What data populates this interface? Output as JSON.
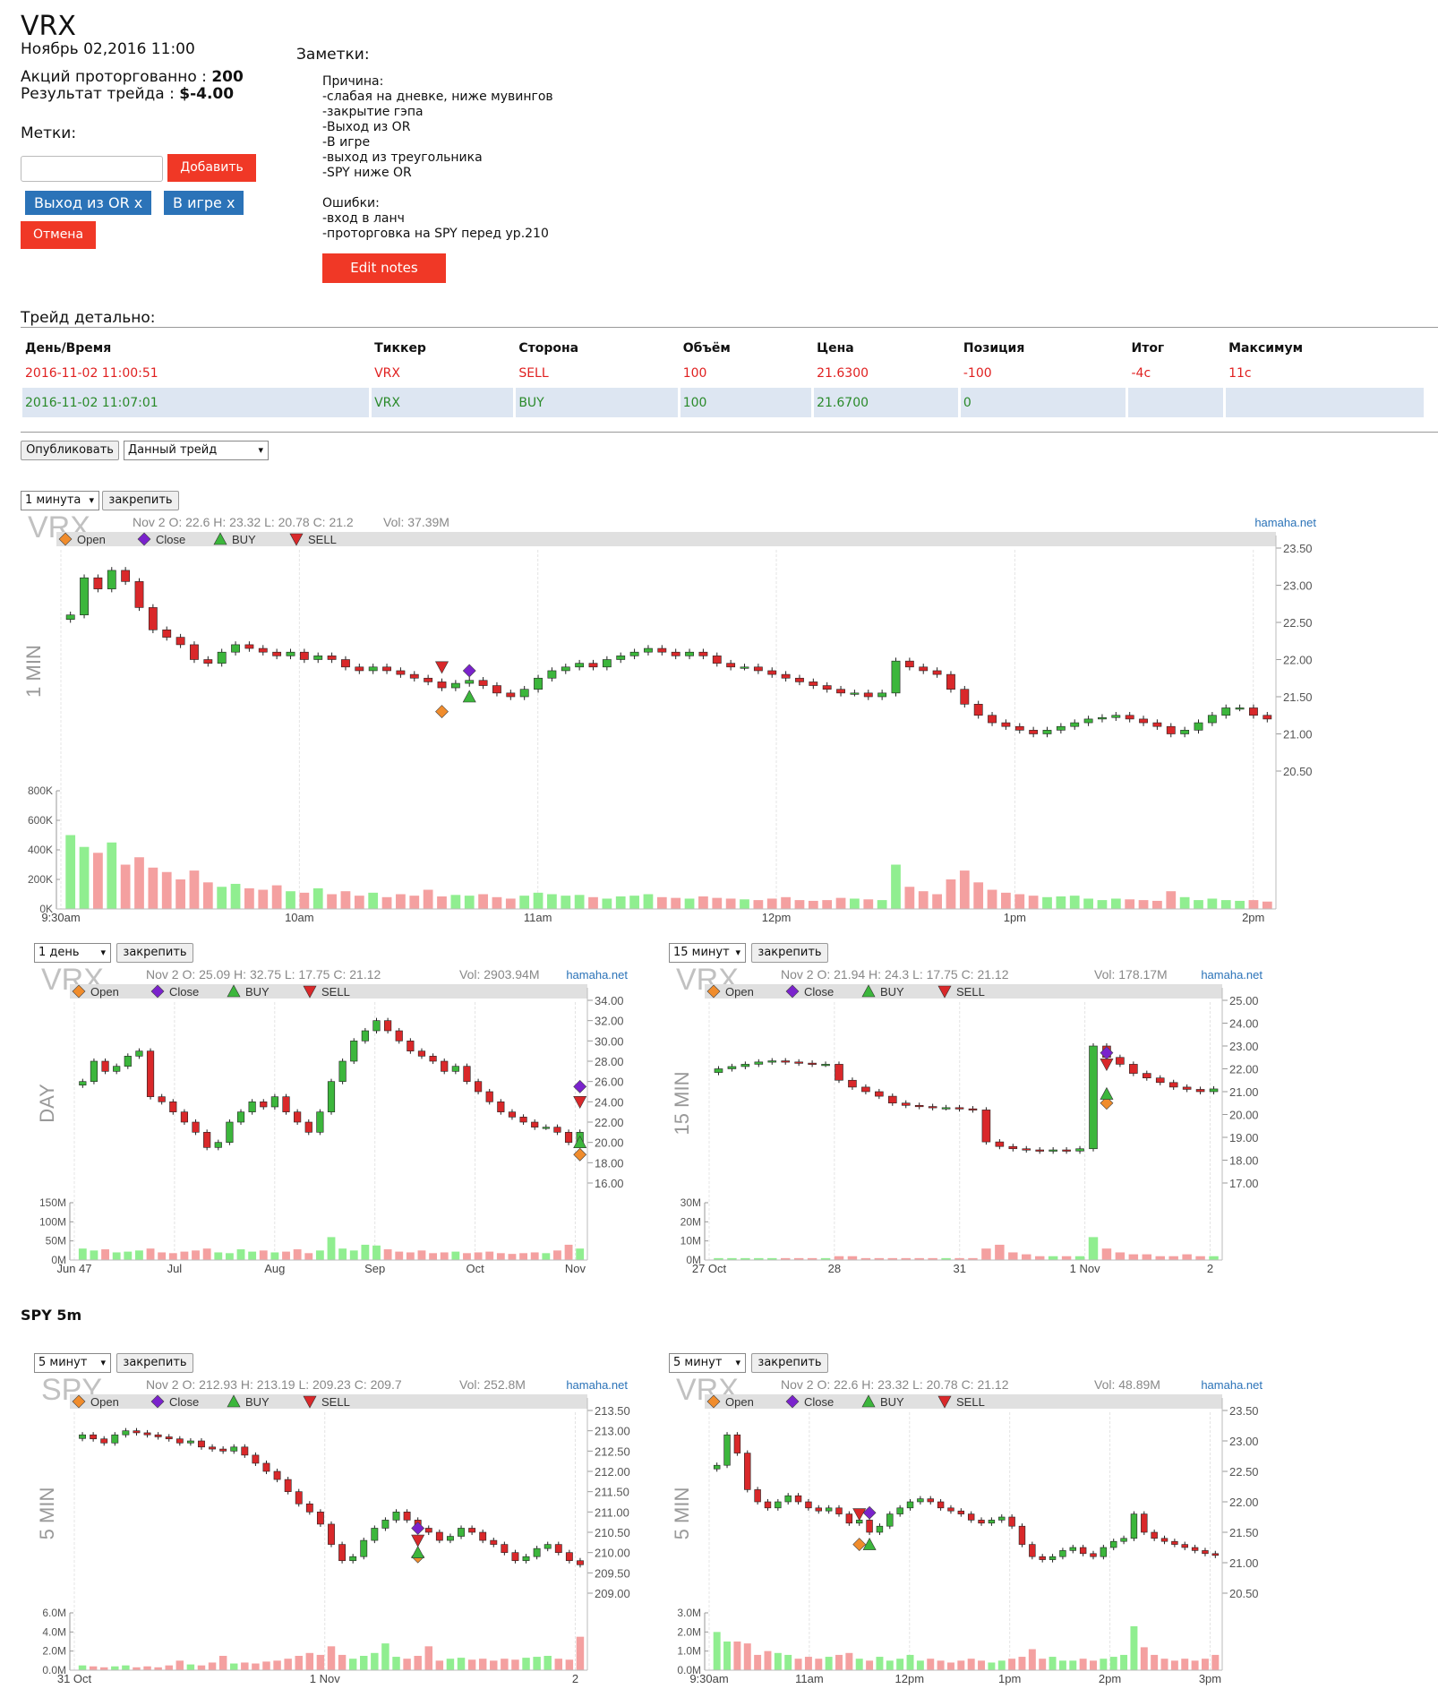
{
  "header": {
    "title": "VRX",
    "date": "Ноябрь 02,2016 11:00",
    "shares_label": "Акций проторгованно :",
    "shares_value": "200",
    "result_label": "Результат трейда :",
    "result_value": "$-4.00",
    "marks_label": "Метки:",
    "add_label": "Добавить",
    "tags": [
      "Выход из OR x",
      "В игре x"
    ],
    "cancel_label": "Отмена"
  },
  "notes": {
    "label": "Заметки:",
    "lines": [
      "Причина:",
      "-слабая на дневке, ниже мувингов",
      "-закрытие гэпа",
      "-Выход из OR",
      "-В игре",
      "-выход из треугольника",
      "-SPY ниже OR",
      "",
      "Ошибки:",
      "-вход в ланч",
      "-проторговка на SPY перед ур.210"
    ],
    "edit_label": "Edit notes"
  },
  "detail": {
    "label": "Трейд детально:",
    "columns": [
      "День/Время",
      "Тиккер",
      "Сторона",
      "Объём",
      "Цена",
      "Позиция",
      "Итог",
      "Максимум"
    ],
    "rows": [
      [
        "2016-11-02 11:00:51",
        "VRX",
        "SELL",
        "100",
        "21.6300",
        "-100",
        "-4c",
        "11c"
      ],
      [
        "2016-11-02 11:07:01",
        "VRX",
        "BUY",
        "100",
        "21.6700",
        "0",
        "",
        ""
      ]
    ]
  },
  "controls": {
    "publish_label": "Опубликовать",
    "trade_select": "Данный трейд",
    "pin_label": "закрепить"
  },
  "spy_title": "SPY 5m",
  "legend": {
    "open": "Open",
    "close": "Close",
    "buy": "BUY",
    "sell": "SELL"
  },
  "colors": {
    "up": "#3cb63c",
    "down": "#d9282a",
    "open_marker": "#f08c2c",
    "close_marker": "#7a22cc",
    "vol_up": "#90ee90",
    "vol_down": "#f4a0a0",
    "button_red": "#f03826",
    "tag_blue": "#2b73b8"
  },
  "chart_data": [
    {
      "type": "candlestick",
      "ticker": "VRX",
      "interval_select": "1 минута",
      "side_label": "1 MIN",
      "info": "Nov 2 O: 22.6 H: 23.32 L: 20.78 C: 21.2",
      "vol": "Vol: 37.39M",
      "watermark": "hamaha.net",
      "yticks": [
        "23.50",
        "23.00",
        "22.50",
        "22.00",
        "21.50",
        "21.00",
        "20.50"
      ],
      "ylim": [
        20.5,
        23.5
      ],
      "vticks": [
        "800K",
        "600K",
        "400K",
        "200K",
        "0K"
      ],
      "vmax": 800,
      "xticks": [
        "9:30am",
        "10am",
        "11am",
        "12pm",
        "1pm",
        "2pm"
      ],
      "points": [
        22.6,
        23.1,
        22.95,
        23.2,
        23.05,
        22.7,
        22.4,
        22.3,
        22.2,
        22.0,
        21.95,
        22.1,
        22.2,
        22.15,
        22.1,
        22.05,
        22.1,
        22.0,
        22.05,
        22.0,
        21.9,
        21.85,
        21.9,
        21.85,
        21.8,
        21.75,
        21.7,
        21.62,
        21.68,
        21.72,
        21.65,
        21.55,
        21.5,
        21.6,
        21.75,
        21.85,
        21.9,
        21.95,
        21.9,
        22.0,
        22.05,
        22.1,
        22.15,
        22.1,
        22.05,
        22.1,
        22.05,
        21.95,
        21.9,
        21.9,
        21.85,
        21.8,
        21.75,
        21.7,
        21.65,
        21.6,
        21.55,
        21.55,
        21.5,
        21.55,
        21.98,
        21.9,
        21.85,
        21.8,
        21.6,
        21.4,
        21.25,
        21.15,
        21.1,
        21.05,
        21.0,
        21.05,
        21.1,
        21.15,
        21.2,
        21.22,
        21.25,
        21.2,
        21.15,
        21.1,
        21.0,
        21.05,
        21.15,
        21.25,
        21.35,
        21.35,
        21.25,
        21.2
      ],
      "volumes": [
        500,
        420,
        380,
        450,
        300,
        350,
        280,
        250,
        200,
        260,
        180,
        150,
        170,
        140,
        130,
        160,
        120,
        110,
        140,
        100,
        120,
        90,
        110,
        80,
        100,
        90,
        130,
        85,
        95,
        90,
        100,
        80,
        70,
        90,
        110,
        100,
        90,
        95,
        80,
        70,
        85,
        90,
        100,
        80,
        75,
        70,
        85,
        75,
        70,
        65,
        60,
        70,
        80,
        60,
        55,
        60,
        75,
        70,
        65,
        60,
        300,
        150,
        120,
        100,
        200,
        260,
        180,
        130,
        110,
        100,
        90,
        80,
        85,
        90,
        70,
        60,
        70,
        65,
        60,
        55,
        120,
        80,
        60,
        70,
        60,
        55,
        60,
        50
      ],
      "markers": {
        "sell": {
          "i": 27,
          "price": 21.9
        },
        "open": {
          "i": 27,
          "price": 21.3
        },
        "close": {
          "i": 29,
          "price": 21.85
        },
        "buy": {
          "i": 29,
          "price": 21.5
        }
      }
    },
    {
      "type": "candlestick",
      "ticker": "VRX",
      "interval_select": "1 день",
      "side_label": "DAY",
      "info": "Nov 2 O: 25.09 H: 32.75 L: 17.75 C: 21.12",
      "vol": "Vol: 2903.94M",
      "watermark": "hamaha.net",
      "yticks": [
        "34.00",
        "32.00",
        "30.00",
        "28.00",
        "26.00",
        "24.00",
        "22.00",
        "20.00",
        "18.00",
        "16.00"
      ],
      "ylim": [
        16,
        34
      ],
      "vticks": [
        "150M",
        "100M",
        "50M",
        "0M"
      ],
      "vmax": 150,
      "xticks": [
        "Jun 47",
        "Jul",
        "Aug",
        "Sep",
        "Oct",
        "Nov"
      ],
      "points": [
        26,
        28,
        27,
        27.5,
        28.5,
        29,
        24.5,
        24,
        23,
        22,
        21,
        19.5,
        20,
        22,
        23,
        24,
        23.5,
        24.5,
        23,
        22,
        21,
        23,
        26,
        28,
        30,
        31,
        32,
        31,
        30,
        29,
        28.5,
        28,
        27,
        27.5,
        26,
        25,
        24,
        23,
        22.5,
        22,
        21.5,
        21.5,
        21,
        20,
        21
      ],
      "volumes": [
        30,
        25,
        28,
        20,
        22,
        25,
        30,
        20,
        18,
        22,
        25,
        30,
        20,
        18,
        28,
        22,
        25,
        20,
        22,
        28,
        18,
        25,
        60,
        30,
        25,
        40,
        38,
        28,
        22,
        20,
        25,
        18,
        20,
        22,
        18,
        20,
        22,
        18,
        16,
        18,
        20,
        18,
        25,
        40,
        30
      ],
      "markers": {
        "close": {
          "i": 44,
          "price": 25.5
        },
        "sell": {
          "i": 44,
          "price": 24
        },
        "buy": {
          "i": 44,
          "price": 20
        },
        "open": {
          "i": 44,
          "price": 18.8
        }
      }
    },
    {
      "type": "candlestick",
      "ticker": "VRX",
      "interval_select": "15 минут",
      "side_label": "15 MIN",
      "info": "Nov 2 O: 21.94 H: 24.3 L: 17.75 C: 21.12",
      "vol": "Vol: 178.17M",
      "watermark": "hamaha.net",
      "yticks": [
        "25.00",
        "24.00",
        "23.00",
        "22.00",
        "21.00",
        "20.00",
        "19.00",
        "18.00",
        "17.00"
      ],
      "ylim": [
        17,
        25
      ],
      "vticks": [
        "30M",
        "20M",
        "10M",
        "0M"
      ],
      "vmax": 30,
      "xticks": [
        "27 Oct",
        "28",
        "31",
        "1 Nov",
        "2"
      ],
      "points": [
        22.0,
        22.1,
        22.2,
        22.3,
        22.35,
        22.3,
        22.25,
        22.2,
        22.2,
        21.5,
        21.2,
        21.0,
        20.8,
        20.5,
        20.4,
        20.35,
        20.3,
        20.3,
        20.25,
        20.2,
        18.8,
        18.6,
        18.5,
        18.45,
        18.4,
        18.45,
        18.4,
        18.5,
        23.0,
        22.5,
        22.2,
        21.8,
        21.6,
        21.4,
        21.2,
        21.1,
        21.0,
        21.12
      ],
      "volumes": [
        1,
        1,
        1,
        1,
        1,
        1,
        1,
        1,
        1,
        2,
        2,
        1,
        1,
        1,
        1,
        1,
        1,
        1,
        1,
        1,
        6,
        8,
        4,
        3,
        2,
        2,
        2,
        2,
        12,
        6,
        4,
        3,
        3,
        2,
        2,
        3,
        2,
        2
      ],
      "markers": {
        "close": {
          "i": 29,
          "price": 22.7
        },
        "sell": {
          "i": 29,
          "price": 22.2
        },
        "buy": {
          "i": 29,
          "price": 20.9
        },
        "open": {
          "i": 29,
          "price": 20.5
        }
      }
    },
    {
      "type": "candlestick",
      "ticker": "SPY",
      "interval_select": "5 минут",
      "side_label": "5 MIN",
      "info": "Nov 2 O: 212.93 H: 213.19 L: 209.23 C: 209.7",
      "vol": "Vol: 252.8M",
      "watermark": "hamaha.net",
      "yticks": [
        "213.50",
        "213.00",
        "212.50",
        "212.00",
        "211.50",
        "211.00",
        "210.50",
        "210.00",
        "209.50",
        "209.00"
      ],
      "ylim": [
        209,
        213.5
      ],
      "vticks": [
        "6.0M",
        "4.0M",
        "2.0M",
        "0.0M"
      ],
      "vmax": 6,
      "xticks": [
        "31 Oct",
        "1 Nov",
        "2"
      ],
      "points": [
        212.9,
        212.8,
        212.7,
        212.9,
        213.0,
        212.95,
        212.9,
        212.85,
        212.8,
        212.7,
        212.75,
        212.6,
        212.55,
        212.5,
        212.6,
        212.4,
        212.2,
        212.0,
        211.8,
        211.5,
        211.2,
        211.0,
        210.7,
        210.2,
        209.8,
        209.9,
        210.3,
        210.6,
        210.8,
        211.0,
        210.8,
        210.6,
        210.5,
        210.3,
        210.4,
        210.6,
        210.5,
        210.3,
        210.2,
        210.0,
        209.8,
        209.9,
        210.1,
        210.2,
        210.0,
        209.8,
        209.7
      ],
      "volumes": [
        0.5,
        0.4,
        0.3,
        0.4,
        0.5,
        0.3,
        0.4,
        0.3,
        0.5,
        1,
        0.6,
        0.5,
        0.8,
        1.5,
        0.7,
        0.8,
        0.7,
        0.9,
        1,
        1.2,
        1.5,
        1.8,
        1.6,
        2.5,
        1.6,
        1.2,
        1.5,
        1.8,
        2.8,
        1.4,
        1.2,
        1.5,
        2.5,
        1,
        1.2,
        1.3,
        1.1,
        1.2,
        1,
        1.2,
        1.1,
        1.3,
        1.4,
        1.5,
        1.2,
        1.1,
        3.5
      ],
      "markers": {
        "close": {
          "i": 31,
          "price": 210.6
        },
        "sell": {
          "i": 31,
          "price": 210.3
        },
        "buy": {
          "i": 31,
          "price": 210.0
        },
        "open": {
          "i": 31,
          "price": 209.9
        }
      }
    },
    {
      "type": "candlestick",
      "ticker": "VRX",
      "interval_select": "5 минут",
      "side_label": "5 MIN",
      "info": "Nov 2 O: 22.6 H: 23.32 L: 20.78 C: 21.12",
      "vol": "Vol: 48.89M",
      "watermark": "hamaha.net",
      "yticks": [
        "23.50",
        "23.00",
        "22.50",
        "22.00",
        "21.50",
        "21.00",
        "20.50"
      ],
      "ylim": [
        20.5,
        23.5
      ],
      "vticks": [
        "3.0M",
        "2.0M",
        "1.0M",
        "0.0M"
      ],
      "vmax": 3,
      "xticks": [
        "9:30am",
        "11am",
        "12pm",
        "1pm",
        "2pm",
        "3pm"
      ],
      "points": [
        22.6,
        23.1,
        22.8,
        22.2,
        22.0,
        21.9,
        22.0,
        22.1,
        22.0,
        21.9,
        21.85,
        21.9,
        21.8,
        21.65,
        21.7,
        21.5,
        21.6,
        21.8,
        21.9,
        22.0,
        22.05,
        22.0,
        21.9,
        21.85,
        21.8,
        21.7,
        21.65,
        21.7,
        21.75,
        21.6,
        21.3,
        21.1,
        21.05,
        21.1,
        21.2,
        21.25,
        21.15,
        21.1,
        21.25,
        21.35,
        21.4,
        21.8,
        21.5,
        21.4,
        21.35,
        21.3,
        21.25,
        21.2,
        21.15,
        21.12
      ],
      "volumes": [
        2,
        1.5,
        1.5,
        1.4,
        0.8,
        1,
        0.9,
        0.8,
        0.6,
        0.7,
        0.6,
        0.7,
        0.8,
        0.9,
        0.6,
        0.5,
        0.7,
        0.5,
        0.6,
        0.8,
        0.5,
        0.6,
        0.5,
        0.4,
        0.5,
        0.6,
        0.5,
        0.4,
        0.5,
        0.6,
        0.7,
        1.1,
        0.6,
        0.7,
        0.5,
        0.5,
        0.6,
        0.5,
        0.6,
        0.7,
        0.8,
        2.3,
        1.2,
        0.8,
        0.6,
        0.5,
        0.6,
        0.5,
        0.6,
        0.8
      ],
      "markers": {
        "sell": {
          "i": 14,
          "price": 21.8
        },
        "close": {
          "i": 15,
          "price": 21.82
        },
        "open": {
          "i": 14,
          "price": 21.3
        },
        "buy": {
          "i": 15,
          "price": 21.3
        }
      }
    }
  ]
}
